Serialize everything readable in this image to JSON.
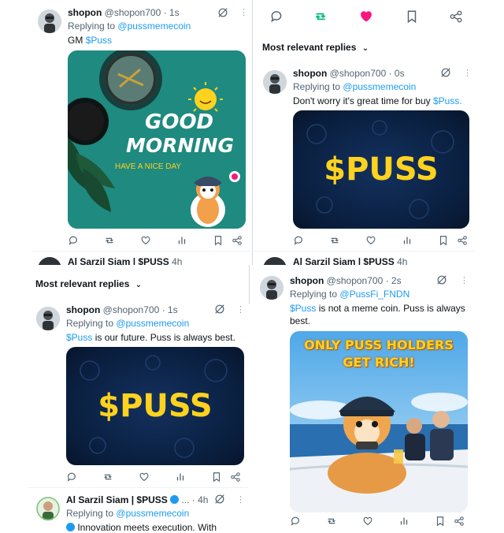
{
  "post1": {
    "user": "shopon",
    "meta": "@shopon700 · 1s",
    "replying_prefix": "Replying to",
    "replying_to": "@pussmemecoin",
    "text_gm": "GM",
    "text_ticker": "$Puss",
    "image": {
      "line1": "GOOD",
      "line2": "MORNING",
      "line3": "HAVE A NICE DAY"
    }
  },
  "post2": {
    "section_title": "Most relevant replies",
    "user": "shopon",
    "meta": "@shopon700 · 0s",
    "replying_prefix": "Replying to",
    "replying_to": "@pussmemecoin",
    "text": "Don't worry it's great time for buy",
    "ticker": "$Puss.",
    "image_text": "$PUSS"
  },
  "post3": {
    "section_title": "Most relevant replies",
    "user": "shopon",
    "meta": "@shopon700 · 1s",
    "replying_prefix": "Replying to",
    "replying_to": "@pussmemecoin",
    "ticker": "$Puss",
    "text": "is our future. Puss is always best.",
    "image_text": "$PUSS",
    "next_user": "Al Sarzil Siam | $PUSS",
    "next_meta": "... · 4h",
    "next_replying_prefix": "Replying to",
    "next_replying_to": "@pussmemecoin",
    "next_text": "Innovation meets execution. With"
  },
  "post4": {
    "user": "shopon",
    "meta": "@shopon700 · 2s",
    "replying_prefix": "Replying to",
    "replying_to": "@PussFi_FNDN",
    "ticker": "$Puss",
    "text1": "is not a meme coin. Puss is always",
    "text2": "best.",
    "image_line1": "ONLY PUSS HOLDERS",
    "image_line2": "GET RICH!"
  },
  "clipped_row": {
    "user": "Al Sarzil Siam | $PUSS",
    "meta": "4h"
  },
  "colors": {
    "link": "#1d9bf0",
    "retweet": "#00ba7c",
    "like": "#f91880",
    "text": "#0f1419",
    "secondary": "#536471",
    "teal": "#1f8a7f",
    "navy": "#0a1f3f",
    "gold": "#ffd21f"
  },
  "icons": [
    "grok-icon",
    "more-icon",
    "reply-icon",
    "retweet-icon",
    "like-icon",
    "views-icon",
    "bookmark-icon",
    "share-icon",
    "chevron-down-icon",
    "verified-icon"
  ]
}
